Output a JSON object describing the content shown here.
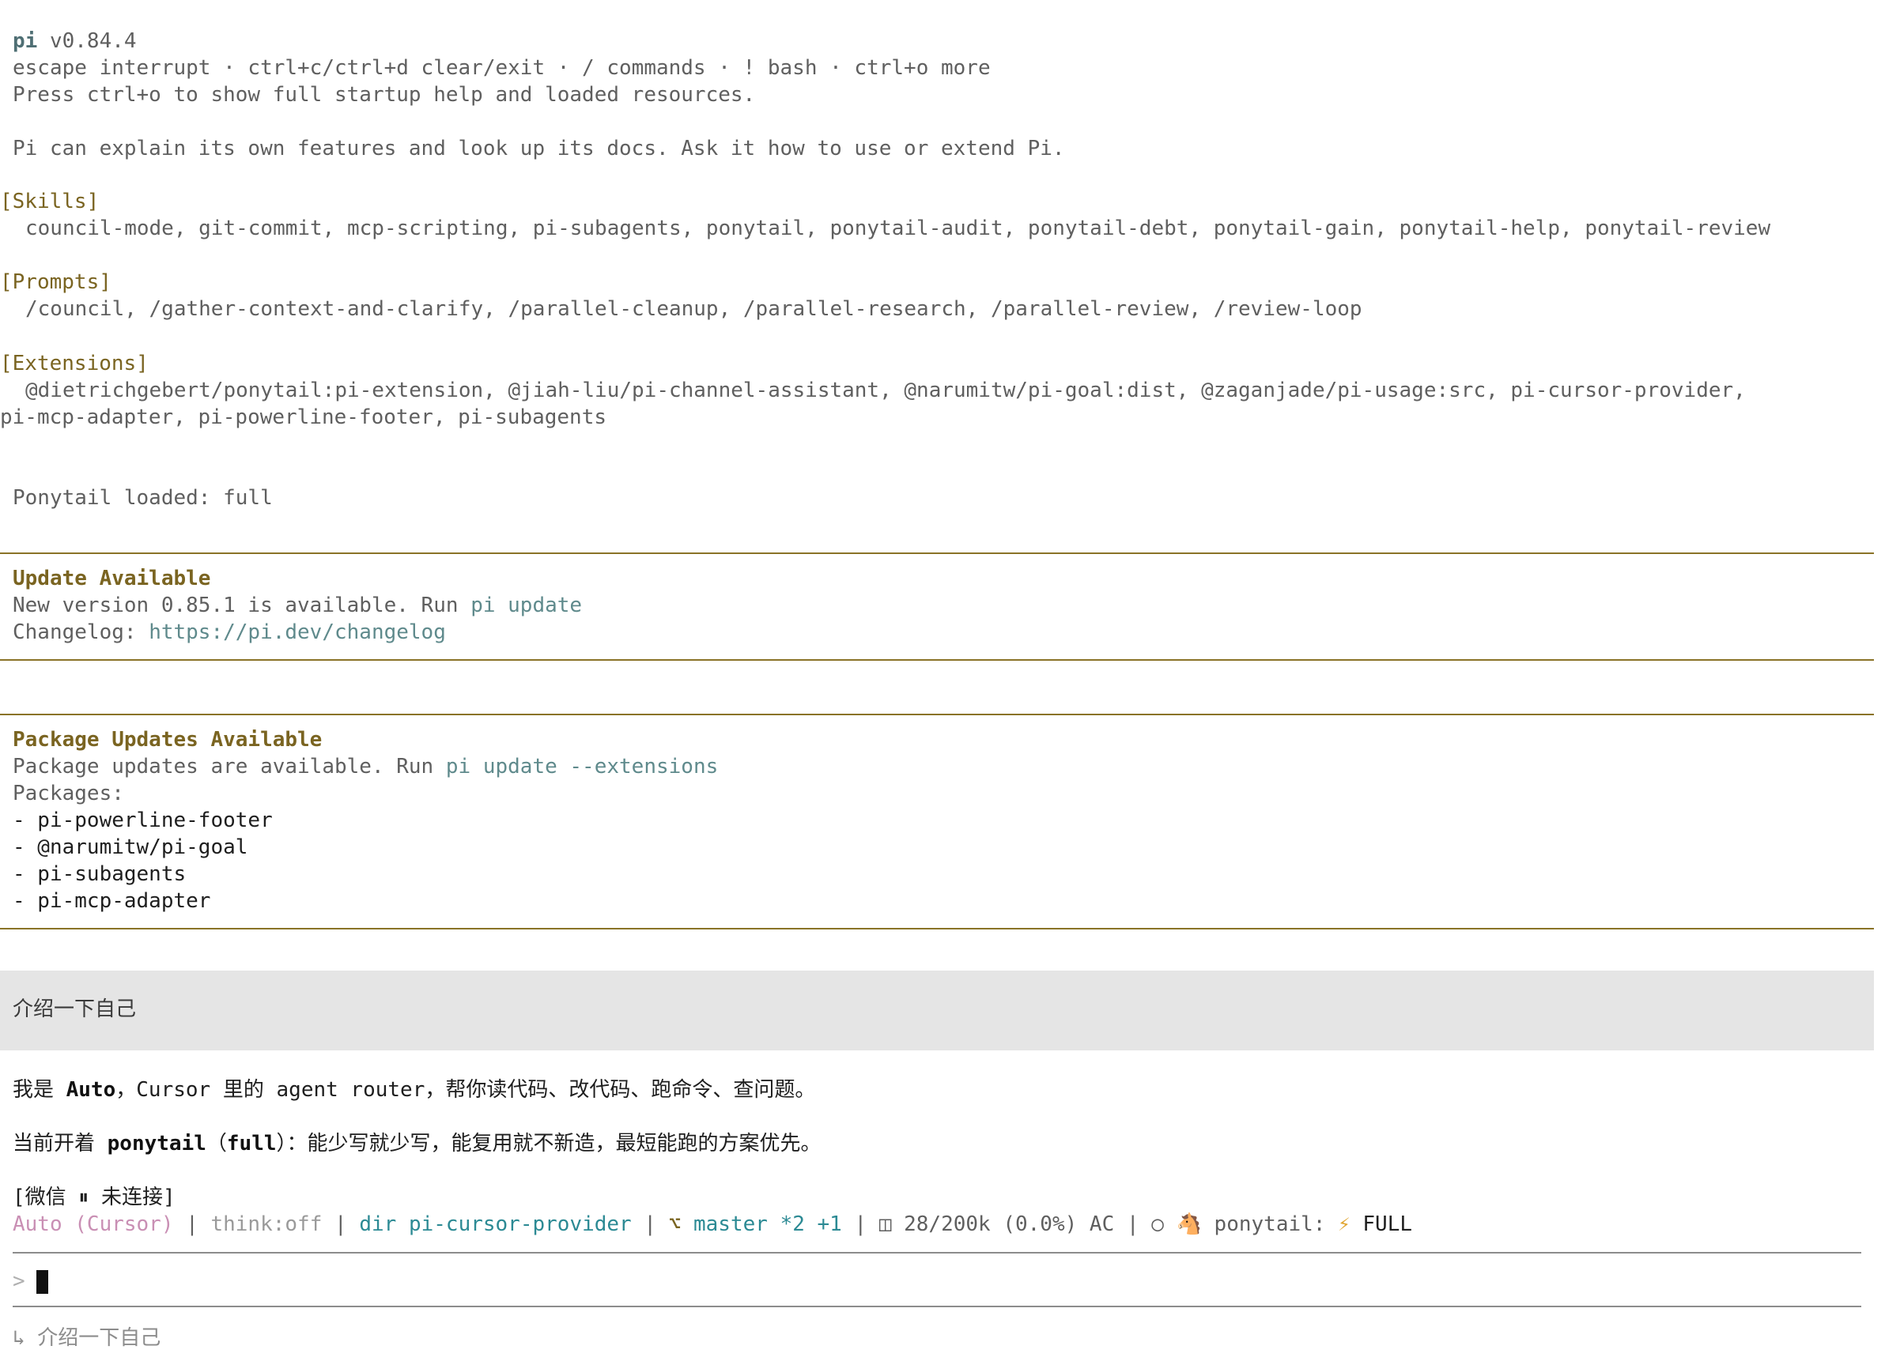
{
  "header": {
    "app_name": "pi",
    "version": "v0.84.4",
    "shortcuts": "escape interrupt · ctrl+c/ctrl+d clear/exit · / commands · ! bash · ctrl+o more",
    "startup_hint": "Press ctrl+o to show full startup help and loaded resources.",
    "intro": "Pi can explain its own features and look up its docs. Ask it how to use or extend Pi."
  },
  "skills": {
    "heading": "[Skills]",
    "list": "council-mode, git-commit, mcp-scripting, pi-subagents, ponytail, ponytail-audit, ponytail-debt, ponytail-gain, ponytail-help, ponytail-review"
  },
  "prompts": {
    "heading": "[Prompts]",
    "list": "/council, /gather-context-and-clarify, /parallel-cleanup, /parallel-research, /parallel-review, /review-loop"
  },
  "extensions": {
    "heading": "[Extensions]",
    "line1": "@dietrichgebert/ponytail:pi-extension, @jiah-liu/pi-channel-assistant, @narumitw/pi-goal:dist, @zaganjade/pi-usage:src, pi-cursor-provider,",
    "line2": "pi-mcp-adapter, pi-powerline-footer, pi-subagents"
  },
  "ponytail_status": "Ponytail loaded: full",
  "update": {
    "title": "Update Available",
    "message_prefix": "New version 0.85.1 is available. Run ",
    "command": "pi update",
    "changelog_label": "Changelog: ",
    "changelog_url": "https://pi.dev/changelog"
  },
  "package_updates": {
    "title": "Package Updates Available",
    "message_prefix": "Package updates are available. Run ",
    "command": "pi update --extensions",
    "packages_label": "Packages:",
    "packages": [
      "- pi-powerline-footer",
      "- @narumitw/pi-goal",
      "- pi-subagents",
      "- pi-mcp-adapter"
    ]
  },
  "conversation": {
    "user_message": "介绍一下自己",
    "reply_line1": {
      "prefix": "我是 ",
      "bold": "Auto",
      "suffix": "，Cursor 里的 agent router，帮你读代码、改代码、跑命令、查问题。"
    },
    "reply_line2": {
      "prefix": "当前开着 ",
      "bold1": "ponytail",
      "middle": "（",
      "bold2": "full",
      "suffix": "）：能少写就少写，能复用就不新造，最短能跑的方案优先。"
    }
  },
  "wechat_status": "[微信 ⏸ 未连接]",
  "status_bar": {
    "model": "Auto (Cursor)",
    "sep": " | ",
    "think": "think:off",
    "dir_label": "dir",
    "dir_name": "pi-cursor-provider",
    "git_icon": "⌥",
    "branch": "master *2 +1",
    "context_icon": "◫",
    "context": "28/200k (0.0%) AC",
    "circle": "○",
    "pony_icon": "🐴",
    "ponytail_label": "ponytail:",
    "bolt": "⚡",
    "mode": "FULL"
  },
  "input": {
    "prompt_symbol": ">",
    "value": ""
  },
  "history_hint": "↳ 介绍一下自己",
  "colors": {
    "rule": "#8a7327",
    "accent": "#7a6421",
    "link": "#5f8a8c",
    "dir": "#2c8a94",
    "model": "#c98fb4",
    "user_bubble": "#e5e5e5"
  }
}
